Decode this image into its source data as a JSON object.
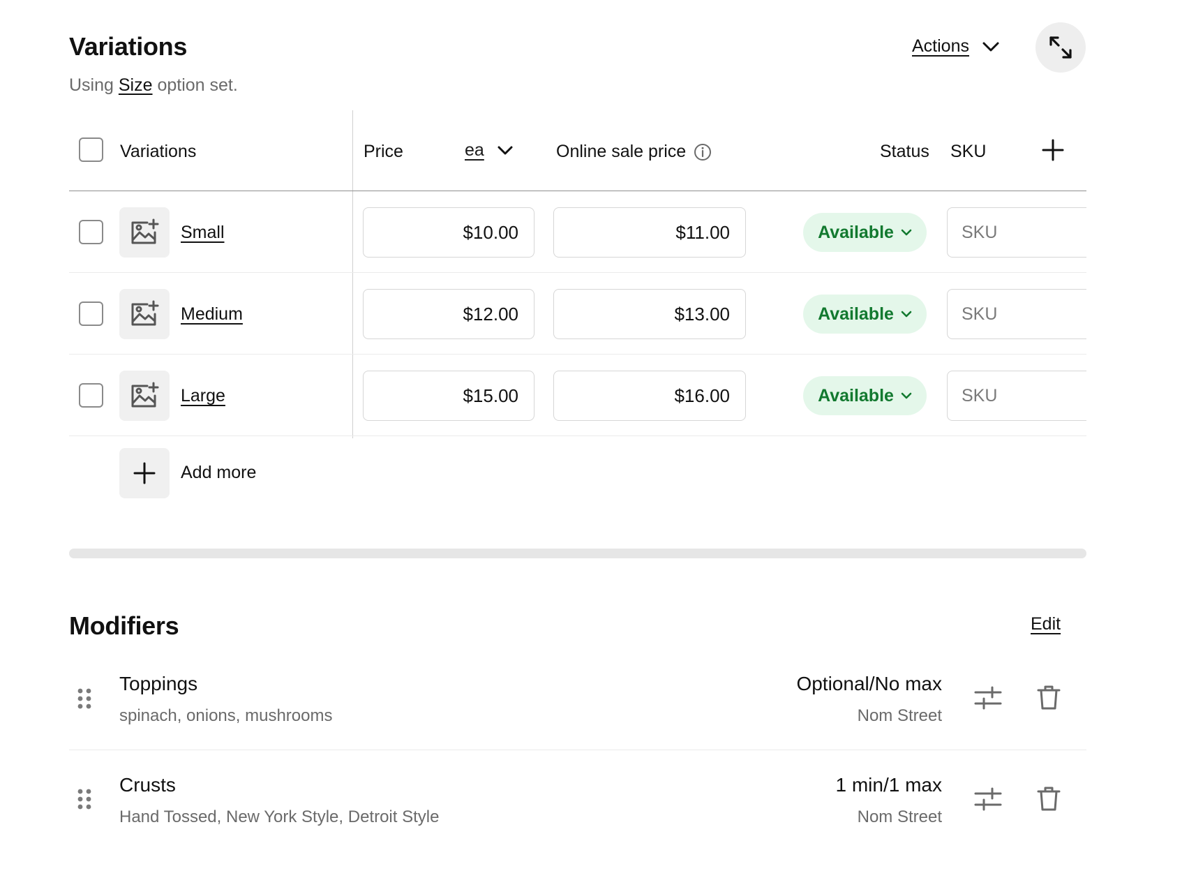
{
  "variations": {
    "title": "Variations",
    "subtitle_prefix": "Using",
    "subtitle_link": "Size",
    "subtitle_suffix": "option set.",
    "actions_label": "Actions",
    "columns": {
      "variations": "Variations",
      "price": "Price",
      "unit": "ea",
      "online_sale_price": "Online sale price",
      "status": "Status",
      "sku": "SKU"
    },
    "rows": [
      {
        "name": "Small",
        "price": "$10.00",
        "online_price": "$11.00",
        "status": "Available",
        "sku_placeholder": "SKU"
      },
      {
        "name": "Medium",
        "price": "$12.00",
        "online_price": "$13.00",
        "status": "Available",
        "sku_placeholder": "SKU"
      },
      {
        "name": "Large",
        "price": "$15.00",
        "online_price": "$16.00",
        "status": "Available",
        "sku_placeholder": "SKU"
      }
    ],
    "add_more_label": "Add more"
  },
  "modifiers": {
    "title": "Modifiers",
    "edit_label": "Edit",
    "items": [
      {
        "name": "Toppings",
        "options": "spinach, onions, mushrooms",
        "rule": "Optional/No max",
        "location": "Nom Street"
      },
      {
        "name": "Crusts",
        "options": "Hand Tossed, New York Style, Detroit Style",
        "rule": "1 min/1 max",
        "location": "Nom Street"
      }
    ]
  },
  "colors": {
    "status_bg": "#e4f7ea",
    "status_text": "#12792f",
    "tile_bg": "#f0f0f0"
  },
  "icons": [
    "expand-icon",
    "chevron-down-icon",
    "info-icon",
    "plus-icon",
    "image-add-icon",
    "drag-handle-icon",
    "sliders-icon",
    "trash-icon"
  ]
}
